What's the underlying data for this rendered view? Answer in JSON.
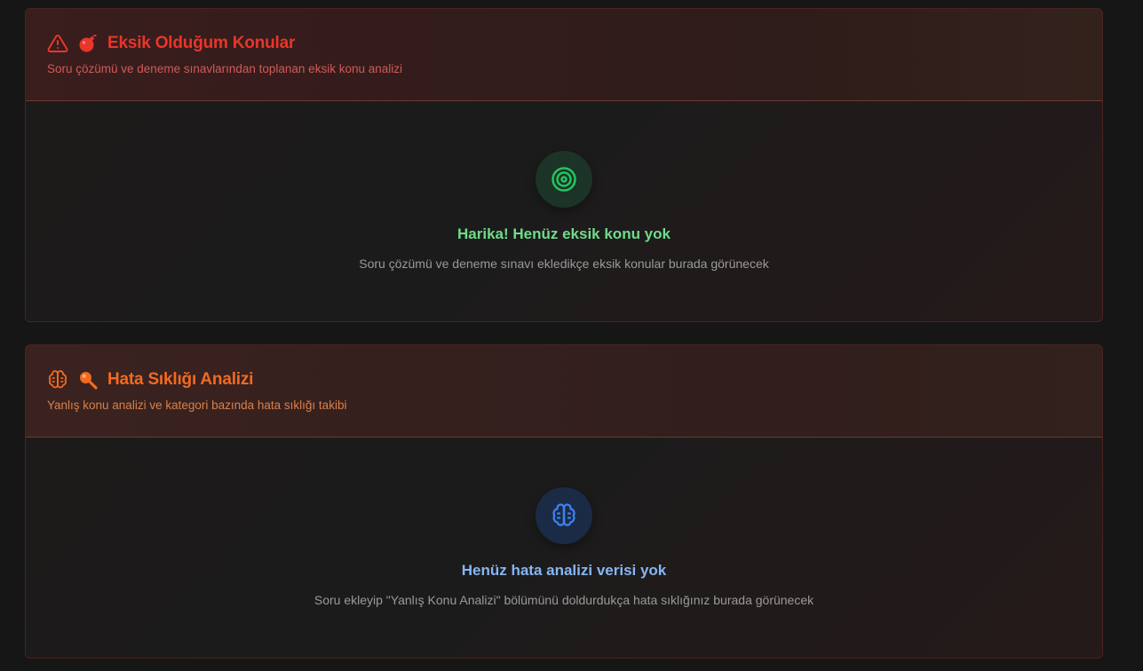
{
  "sections": [
    {
      "title": "Eksik Olduğum Konular",
      "subtitle": "Soru çözümü ve deneme sınavlarından toplanan eksik konu analizi",
      "icons": [
        "warning-triangle-icon",
        "bomb-icon"
      ],
      "empty_state": {
        "icon": "target-icon",
        "title": "Harika! Henüz eksik konu yok",
        "description": "Soru çözümü ve deneme sınavı ekledikçe eksik konular burada görünecek"
      },
      "accent_color": "#e8362b",
      "empty_color": "#22c55e"
    },
    {
      "title": "Hata Sıklığı Analizi",
      "subtitle": "Yanlış konu analizi ve kategori bazında hata sıklığı takibi",
      "icons": [
        "brain-icon",
        "magnifier-icon"
      ],
      "empty_state": {
        "icon": "brain-icon",
        "title": "Henüz hata analizi verisi yok",
        "description": "Soru ekleyip \"Yanlış Konu Analizi\" bölümünü doldurdukça hata sıklığınız burada görünecek"
      },
      "accent_color": "#f26a1f",
      "empty_color": "#3b82f6"
    }
  ]
}
